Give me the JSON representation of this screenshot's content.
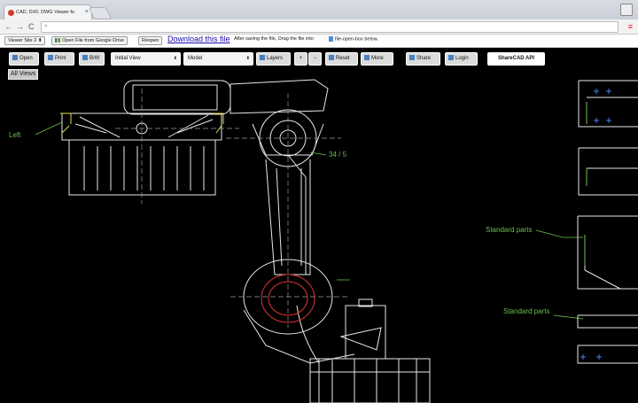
{
  "browser": {
    "tab_title": "CAD, DXF, DWG Viewer fo",
    "tab_close": "×",
    "omnibox_value": "",
    "back": "←",
    "forward": "→",
    "reload": "C",
    "menu": "≡"
  },
  "site": {
    "viewer_select": "Viewer Site 2 ⬍",
    "google_drive_button": "Open File from Google Drive",
    "reopen_button": "Reopen",
    "download_link": "Download this file",
    "instructions_1": "After saving the file, Drag the file into",
    "instructions_2": "file-open-box below."
  },
  "toolbar": {
    "open": "Open",
    "print": "Print",
    "bw": "B/W",
    "view_select": "Initial View",
    "layout_select": "Model",
    "layers": "Layers",
    "zoom_in": "+",
    "zoom_out": "−",
    "reset": "Reset",
    "more": "More",
    "share": "Share",
    "login": "Login",
    "api": "ShareCAD API"
  },
  "drawing": {
    "all_views": "All Views",
    "label_left": "Left",
    "label_ratio": "34 / 5",
    "label_standard_parts_1": "Standard parts",
    "label_standard_parts_2": "Standard parts"
  }
}
